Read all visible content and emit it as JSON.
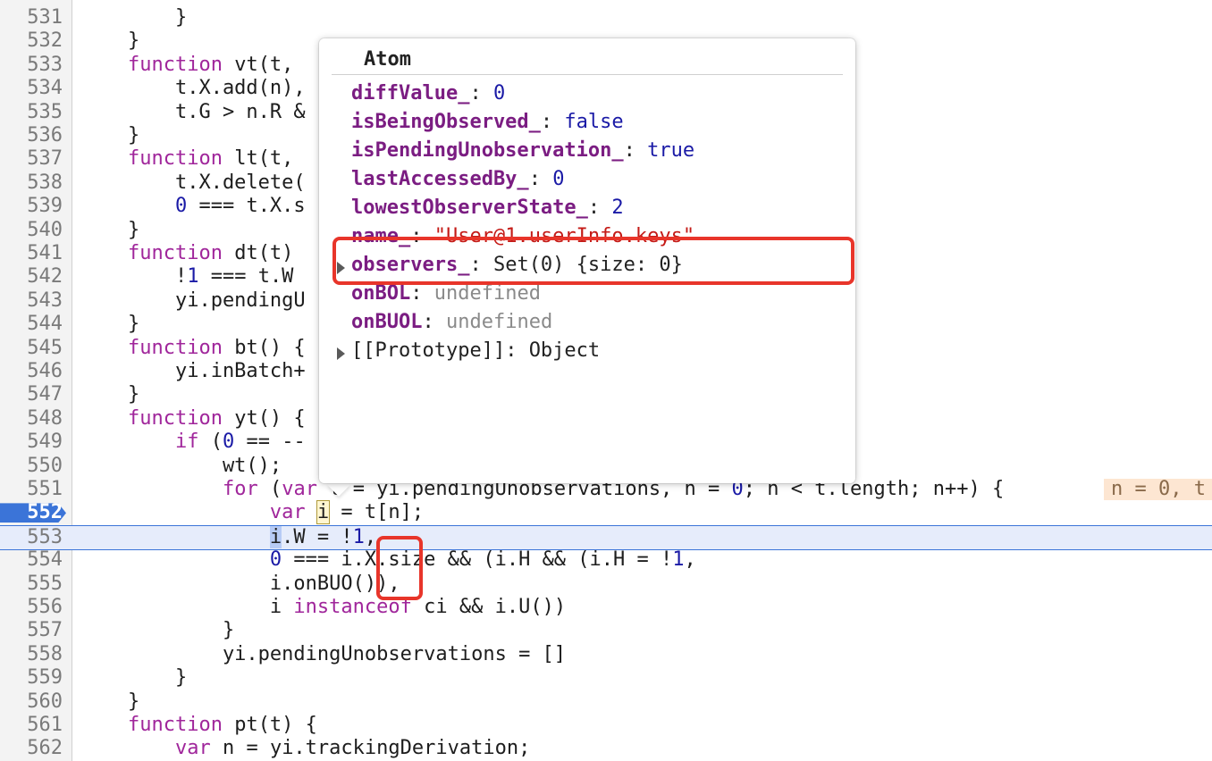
{
  "code_lines": [
    {
      "n": "531",
      "segs": [
        [
          "        }",
          ""
        ]
      ]
    },
    {
      "n": "532",
      "segs": [
        [
          "    }",
          ""
        ]
      ]
    },
    {
      "n": "533",
      "segs": [
        [
          "    ",
          ""
        ],
        [
          "function",
          "kw"
        ],
        [
          " vt(t,",
          ""
        ]
      ]
    },
    {
      "n": "534",
      "segs": [
        [
          "        t.X.add(n),",
          ""
        ]
      ]
    },
    {
      "n": "535",
      "segs": [
        [
          "        t.G > n.R &",
          ""
        ]
      ]
    },
    {
      "n": "536",
      "segs": [
        [
          "    }",
          ""
        ]
      ]
    },
    {
      "n": "537",
      "segs": [
        [
          "    ",
          ""
        ],
        [
          "function",
          "kw"
        ],
        [
          " lt(t,",
          ""
        ]
      ]
    },
    {
      "n": "538",
      "segs": [
        [
          "        t.X.delete(",
          ""
        ]
      ]
    },
    {
      "n": "539",
      "segs": [
        [
          "        ",
          ""
        ],
        [
          "0",
          "num"
        ],
        [
          " === t.X.s",
          ""
        ]
      ]
    },
    {
      "n": "540",
      "segs": [
        [
          "    }",
          ""
        ]
      ]
    },
    {
      "n": "541",
      "segs": [
        [
          "    ",
          ""
        ],
        [
          "function",
          "kw"
        ],
        [
          " dt(t)",
          ""
        ]
      ]
    },
    {
      "n": "542",
      "segs": [
        [
          "        !",
          ""
        ],
        [
          "1",
          "num"
        ],
        [
          " === t.W",
          ""
        ]
      ]
    },
    {
      "n": "543",
      "segs": [
        [
          "        yi.pendingU",
          ""
        ]
      ]
    },
    {
      "n": "544",
      "segs": [
        [
          "    }",
          ""
        ]
      ]
    },
    {
      "n": "545",
      "segs": [
        [
          "    ",
          ""
        ],
        [
          "function",
          "kw"
        ],
        [
          " bt() {",
          ""
        ]
      ]
    },
    {
      "n": "546",
      "segs": [
        [
          "        yi.inBatch+",
          ""
        ]
      ]
    },
    {
      "n": "547",
      "segs": [
        [
          "    }",
          ""
        ]
      ]
    },
    {
      "n": "548",
      "segs": [
        [
          "    ",
          ""
        ],
        [
          "function",
          "kw"
        ],
        [
          " yt() {",
          ""
        ]
      ]
    },
    {
      "n": "549",
      "segs": [
        [
          "        ",
          ""
        ],
        [
          "if",
          "kw"
        ],
        [
          " (",
          ""
        ],
        [
          "0",
          "num"
        ],
        [
          " == --",
          ""
        ]
      ]
    },
    {
      "n": "550",
      "segs": [
        [
          "            wt();",
          ""
        ]
      ]
    },
    {
      "n": "551",
      "segs": [
        [
          "            ",
          ""
        ],
        [
          "for",
          "kw"
        ],
        [
          " (",
          ""
        ],
        [
          "var",
          "kw"
        ],
        [
          " t = yi.pendingUnobservations, n = ",
          ""
        ],
        [
          "0",
          "num"
        ],
        [
          "; n < t.length; n++) {",
          ""
        ]
      ]
    },
    {
      "n": "552",
      "segs": [
        [
          "                ",
          ""
        ],
        [
          "var",
          "kw"
        ],
        [
          " ",
          ""
        ],
        [
          "i",
          "hl-var"
        ],
        [
          " = t[n];",
          ""
        ]
      ]
    },
    {
      "n": "553",
      "segs": [
        [
          "                ",
          ""
        ],
        [
          "i",
          "sel-var"
        ],
        [
          ".W = !",
          ""
        ],
        [
          "1",
          "num"
        ],
        [
          ",",
          ""
        ]
      ]
    },
    {
      "n": "554",
      "segs": [
        [
          "                ",
          ""
        ],
        [
          "0",
          "num"
        ],
        [
          " === i.X.size && (i.H && (i.H = !",
          ""
        ],
        [
          "1",
          "num"
        ],
        [
          ",",
          ""
        ]
      ]
    },
    {
      "n": "555",
      "segs": [
        [
          "                i.onBUO()),",
          ""
        ]
      ]
    },
    {
      "n": "556",
      "segs": [
        [
          "                i ",
          ""
        ],
        [
          "instanceof",
          "kw"
        ],
        [
          " ci && i.U())",
          ""
        ]
      ]
    },
    {
      "n": "557",
      "segs": [
        [
          "            }",
          ""
        ]
      ]
    },
    {
      "n": "558",
      "segs": [
        [
          "            yi.pendingUnobservations = []",
          ""
        ]
      ]
    },
    {
      "n": "559",
      "segs": [
        [
          "        }",
          ""
        ]
      ]
    },
    {
      "n": "560",
      "segs": [
        [
          "    }",
          ""
        ]
      ]
    },
    {
      "n": "561",
      "segs": [
        [
          "    ",
          ""
        ],
        [
          "function",
          "kw"
        ],
        [
          " pt(t) {",
          ""
        ]
      ]
    },
    {
      "n": "562",
      "segs": [
        [
          "        ",
          ""
        ],
        [
          "var",
          "kw"
        ],
        [
          " n = yi.trackingDerivation;",
          ""
        ]
      ]
    }
  ],
  "paused_line": "552",
  "inline_value": "n = 0, t",
  "popover": {
    "title": "Atom",
    "properties": [
      {
        "key": "diffValue_",
        "value": "0",
        "type": "pnum",
        "expandable": false
      },
      {
        "key": "isBeingObserved_",
        "value": "false",
        "type": "pbool",
        "expandable": false
      },
      {
        "key": "isPendingUnobservation_",
        "value": "true",
        "type": "pbool",
        "expandable": false
      },
      {
        "key": "lastAccessedBy_",
        "value": "0",
        "type": "pnum",
        "expandable": false
      },
      {
        "key": "lowestObserverState_",
        "value": "2",
        "type": "pnum",
        "expandable": false
      },
      {
        "key": "name_",
        "value": "\"User@1.userInfo.keys\"",
        "type": "pstr",
        "expandable": false
      },
      {
        "key": "observers_",
        "value": "Set(0) {size: 0}",
        "type": "pobj",
        "expandable": true
      },
      {
        "key": "onBOL",
        "value": "undefined",
        "type": "pundef",
        "expandable": false
      },
      {
        "key": "onBUOL",
        "value": "undefined",
        "type": "pundef",
        "expandable": false
      },
      {
        "key": "[[Prototype]]",
        "value": "Object",
        "type": "pobj",
        "expandable": true,
        "plain_key": true
      }
    ]
  },
  "colors": {
    "annotation": "#e8352a",
    "breakpoint": "#3b74d8"
  }
}
